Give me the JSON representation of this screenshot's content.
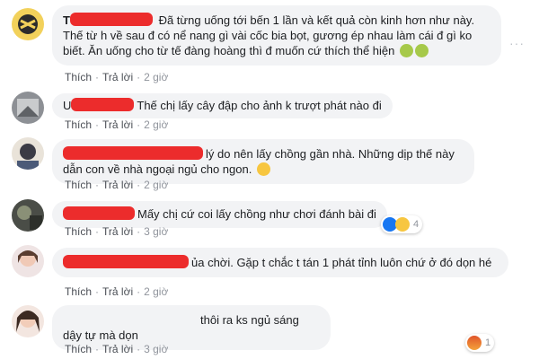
{
  "more_icon": "more-horizontal-icon",
  "colors": {
    "bubble_bg": "#f2f3f5",
    "redaction": "#ec2c2c",
    "link": "#4b4f56",
    "meta": "#90949c"
  },
  "comments": [
    {
      "author_prefix": "T",
      "text": "Đã từng uống tới bến 1 lần và kết quả còn kinh hơn như này. Thế từ h về sau đ có nể nang gì vài cốc bia bọt, gương ép nhau làm cái đ gì ko biết. Ăn uống cho từ tế đàng hoàng thì đ muốn cứ thích thể hiện",
      "emojis": [
        "sick-face-icon",
        "nauseated-face-icon"
      ],
      "like": "Thích",
      "reply": "Trả lời",
      "time": "2 giờ"
    },
    {
      "author_prefix": "U",
      "text": "Thế chị lấy cây đập cho ảnh k trượt phát nào đi",
      "like": "Thích",
      "reply": "Trả lời",
      "time": "2 giờ"
    },
    {
      "author_prefix": "",
      "text": "lý do nên lấy chồng gần nhà. Những dịp thế này dẫn con về nhà ngoại ngủ cho ngon.",
      "emojis": [
        "grinning-face-icon"
      ],
      "like": "Thích",
      "reply": "Trả lời",
      "time": "2 giờ"
    },
    {
      "author_prefix": "",
      "text": "Mấy chị cứ coi lấy chồng như chơi đánh bài đi",
      "like": "Thích",
      "reply": "Trả lời",
      "time": "3 giờ",
      "reactions": {
        "icons": [
          "like-reaction-icon",
          "haha-reaction-icon"
        ],
        "count": "4"
      }
    },
    {
      "author_prefix": "",
      "text": "ủa chời. Gặp t chắc t tán 1 phát tỉnh luôn chứ ở đó dọn hé",
      "like": "Thích",
      "reply": "Trả lời",
      "time": "2 giờ"
    },
    {
      "author_prefix": "",
      "text": "thôi ra ks ngủ sáng dậy tự mà dọn",
      "like": "Thích",
      "reply": "Trả lời",
      "time": "3 giờ",
      "reactions": {
        "icons": [
          "angry-reaction-icon"
        ],
        "count": "1"
      }
    }
  ]
}
